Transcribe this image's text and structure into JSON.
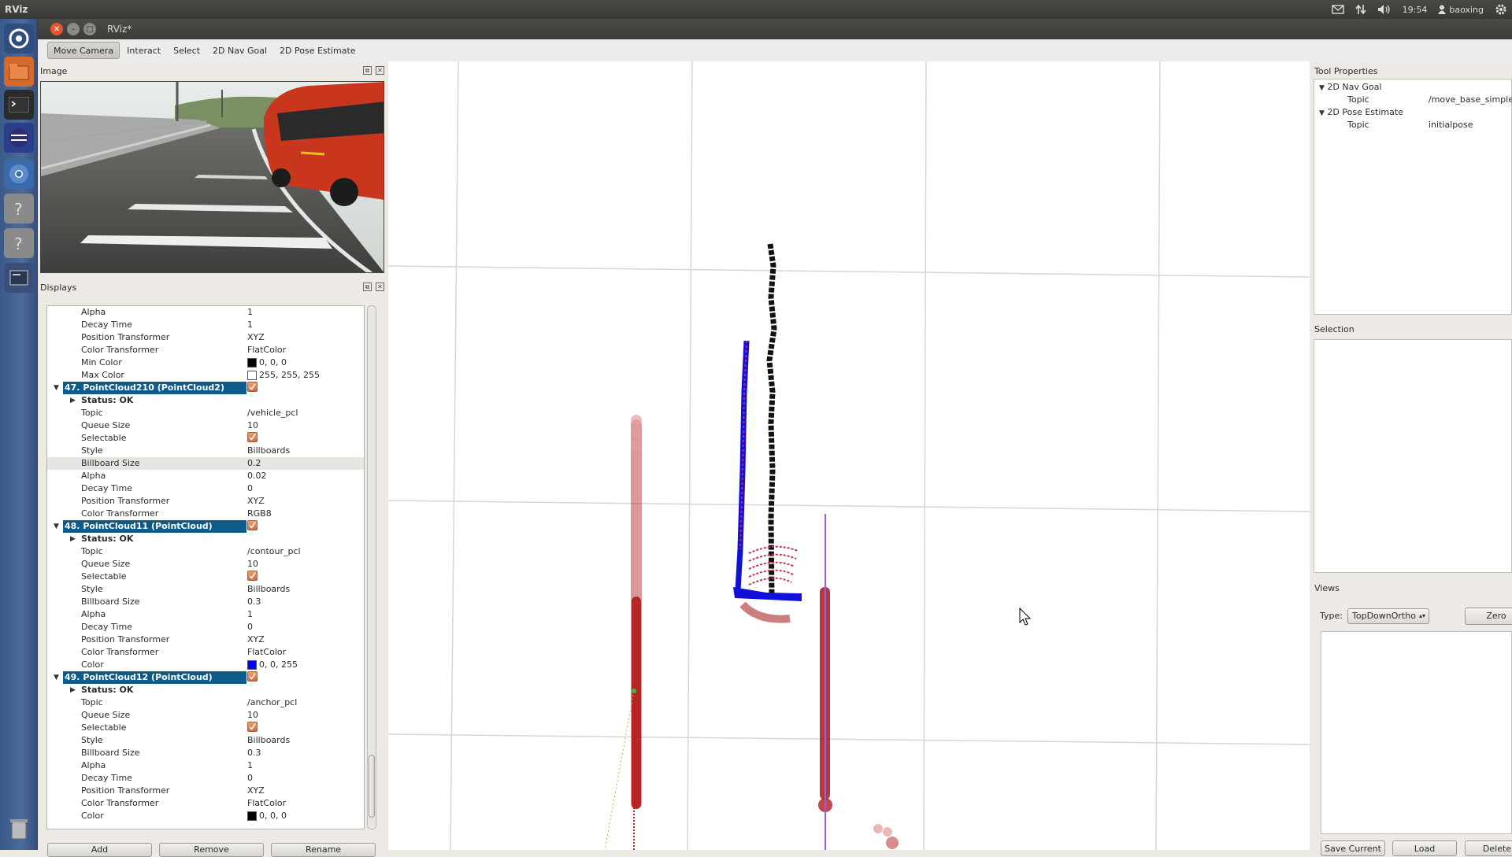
{
  "system": {
    "app_name": "RViz",
    "clock": "19:54",
    "user": "baoxing"
  },
  "window": {
    "title": "RViz*"
  },
  "toolbar": [
    "Move Camera",
    "Interact",
    "Select",
    "2D Nav Goal",
    "2D Pose Estimate"
  ],
  "image_panel": {
    "title": "Image"
  },
  "displays_panel": {
    "title": "Displays",
    "rows": [
      {
        "kind": "prop",
        "key": "Alpha",
        "value": "1"
      },
      {
        "kind": "prop",
        "key": "Decay Time",
        "value": "1"
      },
      {
        "kind": "prop",
        "key": "Position Transformer",
        "value": "XYZ"
      },
      {
        "kind": "prop",
        "key": "Color Transformer",
        "value": "FlatColor"
      },
      {
        "kind": "color",
        "key": "Min Color",
        "value": "0, 0, 0",
        "color": "#000000"
      },
      {
        "kind": "color",
        "key": "Max Color",
        "value": "255, 255, 255",
        "color": "#ffffff"
      },
      {
        "kind": "display",
        "key": "47. PointCloud210 (PointCloud2)"
      },
      {
        "kind": "status",
        "key": "Status: OK"
      },
      {
        "kind": "prop",
        "key": "Topic",
        "value": "/vehicle_pcl"
      },
      {
        "kind": "prop",
        "key": "Queue Size",
        "value": "10"
      },
      {
        "kind": "check",
        "key": "Selectable"
      },
      {
        "kind": "prop",
        "key": "Style",
        "value": "Billboards"
      },
      {
        "kind": "prop",
        "key": "Billboard Size",
        "value": "0.2",
        "selected": true
      },
      {
        "kind": "prop",
        "key": "Alpha",
        "value": "0.02"
      },
      {
        "kind": "prop",
        "key": "Decay Time",
        "value": "0"
      },
      {
        "kind": "prop",
        "key": "Position Transformer",
        "value": "XYZ"
      },
      {
        "kind": "prop",
        "key": "Color Transformer",
        "value": "RGB8"
      },
      {
        "kind": "display",
        "key": "48. PointCloud11 (PointCloud)"
      },
      {
        "kind": "status",
        "key": "Status: OK"
      },
      {
        "kind": "prop",
        "key": "Topic",
        "value": "/contour_pcl"
      },
      {
        "kind": "prop",
        "key": "Queue Size",
        "value": "10"
      },
      {
        "kind": "check",
        "key": "Selectable"
      },
      {
        "kind": "prop",
        "key": "Style",
        "value": "Billboards"
      },
      {
        "kind": "prop",
        "key": "Billboard Size",
        "value": "0.3"
      },
      {
        "kind": "prop",
        "key": "Alpha",
        "value": "1"
      },
      {
        "kind": "prop",
        "key": "Decay Time",
        "value": "0"
      },
      {
        "kind": "prop",
        "key": "Position Transformer",
        "value": "XYZ"
      },
      {
        "kind": "prop",
        "key": "Color Transformer",
        "value": "FlatColor"
      },
      {
        "kind": "color",
        "key": "Color",
        "value": "0, 0, 255",
        "color": "#0000ff"
      },
      {
        "kind": "display",
        "key": "49. PointCloud12 (PointCloud)"
      },
      {
        "kind": "status",
        "key": "Status: OK"
      },
      {
        "kind": "prop",
        "key": "Topic",
        "value": "/anchor_pcl"
      },
      {
        "kind": "prop",
        "key": "Queue Size",
        "value": "10"
      },
      {
        "kind": "check",
        "key": "Selectable"
      },
      {
        "kind": "prop",
        "key": "Style",
        "value": "Billboards"
      },
      {
        "kind": "prop",
        "key": "Billboard Size",
        "value": "0.3"
      },
      {
        "kind": "prop",
        "key": "Alpha",
        "value": "1"
      },
      {
        "kind": "prop",
        "key": "Decay Time",
        "value": "0"
      },
      {
        "kind": "prop",
        "key": "Position Transformer",
        "value": "XYZ"
      },
      {
        "kind": "prop",
        "key": "Color Transformer",
        "value": "FlatColor"
      },
      {
        "kind": "color",
        "key": "Color",
        "value": "0, 0, 0",
        "color": "#000000"
      }
    ],
    "buttons": [
      "Add",
      "Remove",
      "Rename"
    ]
  },
  "tool_properties": {
    "title": "Tool Properties",
    "groups": [
      {
        "name": "2D Nav Goal",
        "key": "Topic",
        "value": "/move_base_simple/..."
      },
      {
        "name": "2D Pose Estimate",
        "key": "Topic",
        "value": "initialpose"
      }
    ]
  },
  "selection_panel": {
    "title": "Selection"
  },
  "views_panel": {
    "title": "Views",
    "type_label": "Type:",
    "type_value": "TopDownOrtho",
    "zero_label": "Zero",
    "buttons": [
      "Save Current",
      "Load",
      "Delete"
    ]
  }
}
